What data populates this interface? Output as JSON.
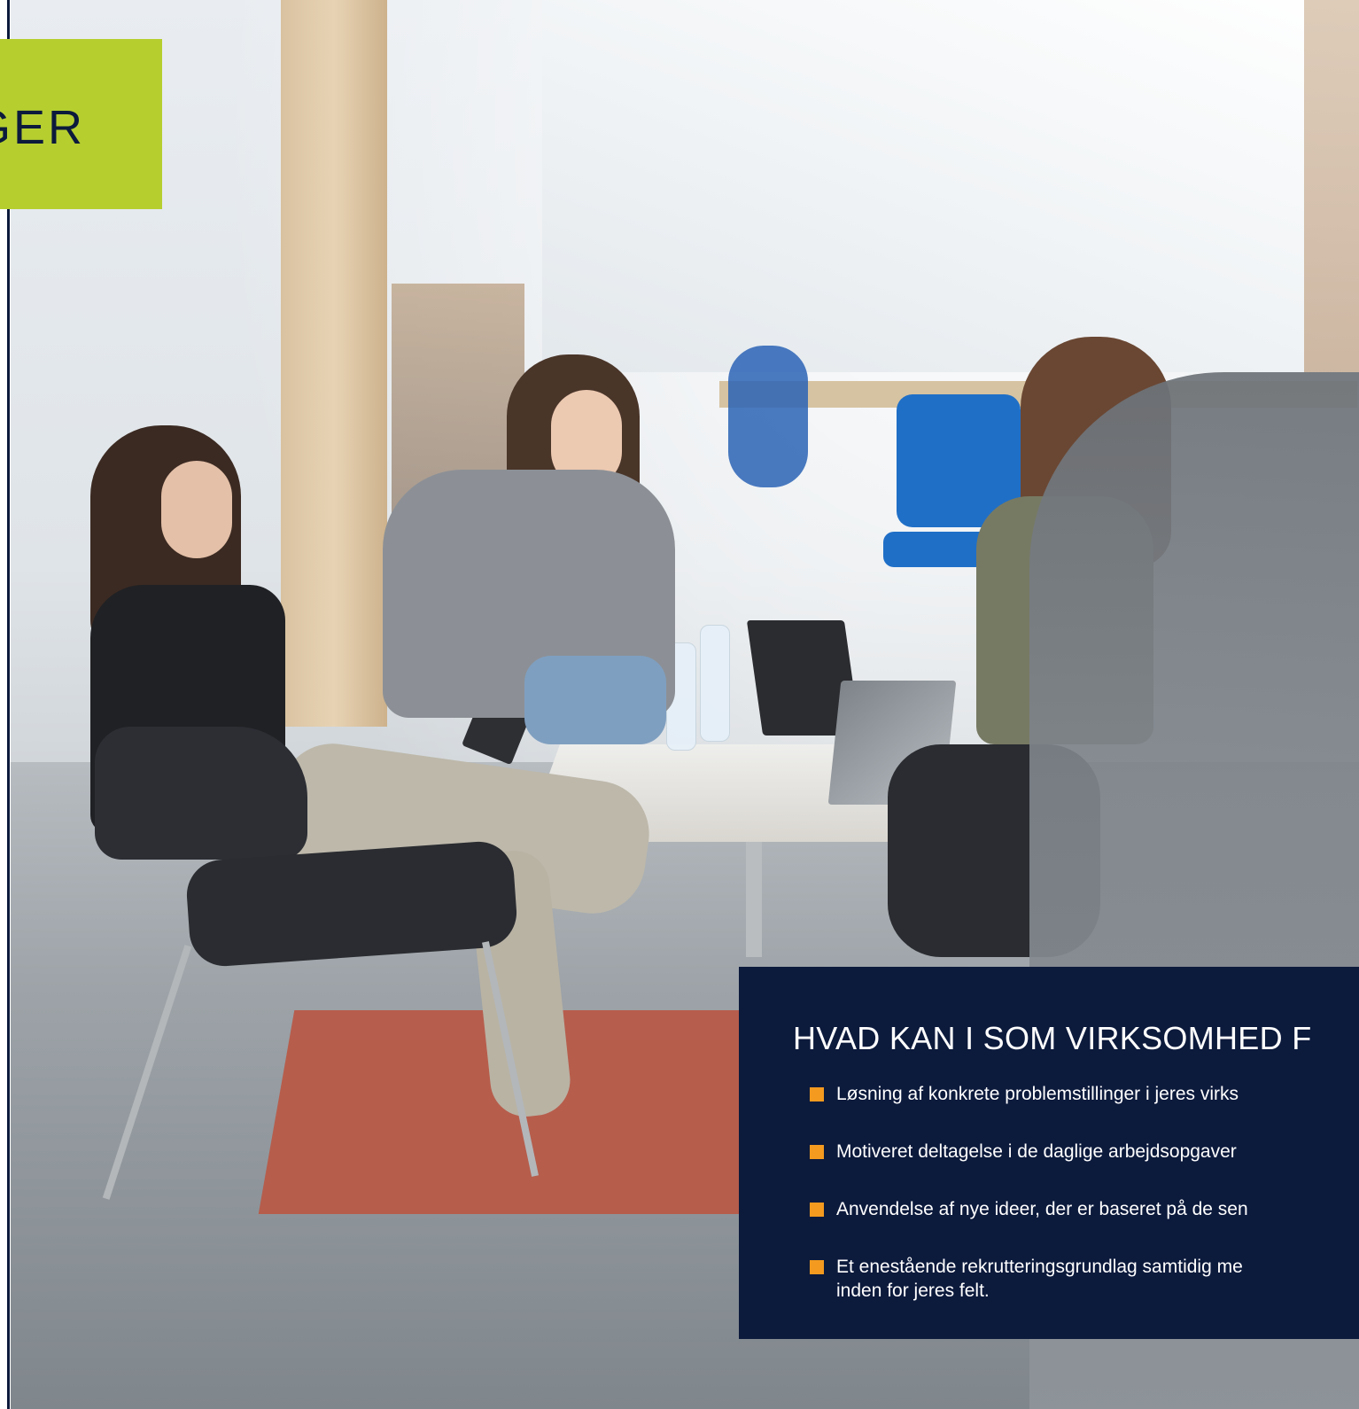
{
  "label": {
    "text": "GER"
  },
  "panel": {
    "title": "HVAD  KAN  I SOM VIRKSOMHED F",
    "items": [
      {
        "lines": [
          "Løsning af konkrete problemstillinger i jeres virks"
        ]
      },
      {
        "lines": [
          "Motiveret deltagelse i de daglige arbejdsopgaver"
        ]
      },
      {
        "lines": [
          "Anvendelse af nye ideer, der er baseret på de sen"
        ]
      },
      {
        "lines": [
          "Et enestående rekrutteringsgrundlag samtidig me",
          "inden for jeres felt."
        ]
      }
    ]
  },
  "colors": {
    "navy": "#0c1a3c",
    "green": "#b6cf2f",
    "bullet": "#f39a1f"
  }
}
